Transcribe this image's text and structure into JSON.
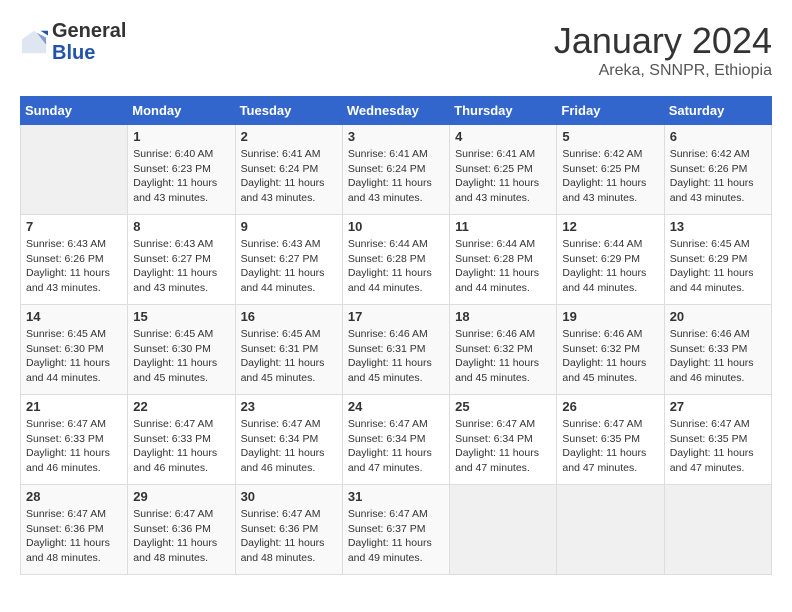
{
  "header": {
    "logo_general": "General",
    "logo_blue": "Blue",
    "month_title": "January 2024",
    "location": "Areka, SNNPR, Ethiopia"
  },
  "weekdays": [
    "Sunday",
    "Monday",
    "Tuesday",
    "Wednesday",
    "Thursday",
    "Friday",
    "Saturday"
  ],
  "weeks": [
    [
      {
        "day": "",
        "empty": true
      },
      {
        "day": "1",
        "sunrise": "6:40 AM",
        "sunset": "6:23 PM",
        "daylight": "11 hours and 43 minutes."
      },
      {
        "day": "2",
        "sunrise": "6:41 AM",
        "sunset": "6:24 PM",
        "daylight": "11 hours and 43 minutes."
      },
      {
        "day": "3",
        "sunrise": "6:41 AM",
        "sunset": "6:24 PM",
        "daylight": "11 hours and 43 minutes."
      },
      {
        "day": "4",
        "sunrise": "6:41 AM",
        "sunset": "6:25 PM",
        "daylight": "11 hours and 43 minutes."
      },
      {
        "day": "5",
        "sunrise": "6:42 AM",
        "sunset": "6:25 PM",
        "daylight": "11 hours and 43 minutes."
      },
      {
        "day": "6",
        "sunrise": "6:42 AM",
        "sunset": "6:26 PM",
        "daylight": "11 hours and 43 minutes."
      }
    ],
    [
      {
        "day": "7",
        "sunrise": "6:43 AM",
        "sunset": "6:26 PM",
        "daylight": "11 hours and 43 minutes."
      },
      {
        "day": "8",
        "sunrise": "6:43 AM",
        "sunset": "6:27 PM",
        "daylight": "11 hours and 43 minutes."
      },
      {
        "day": "9",
        "sunrise": "6:43 AM",
        "sunset": "6:27 PM",
        "daylight": "11 hours and 44 minutes."
      },
      {
        "day": "10",
        "sunrise": "6:44 AM",
        "sunset": "6:28 PM",
        "daylight": "11 hours and 44 minutes."
      },
      {
        "day": "11",
        "sunrise": "6:44 AM",
        "sunset": "6:28 PM",
        "daylight": "11 hours and 44 minutes."
      },
      {
        "day": "12",
        "sunrise": "6:44 AM",
        "sunset": "6:29 PM",
        "daylight": "11 hours and 44 minutes."
      },
      {
        "day": "13",
        "sunrise": "6:45 AM",
        "sunset": "6:29 PM",
        "daylight": "11 hours and 44 minutes."
      }
    ],
    [
      {
        "day": "14",
        "sunrise": "6:45 AM",
        "sunset": "6:30 PM",
        "daylight": "11 hours and 44 minutes."
      },
      {
        "day": "15",
        "sunrise": "6:45 AM",
        "sunset": "6:30 PM",
        "daylight": "11 hours and 45 minutes."
      },
      {
        "day": "16",
        "sunrise": "6:45 AM",
        "sunset": "6:31 PM",
        "daylight": "11 hours and 45 minutes."
      },
      {
        "day": "17",
        "sunrise": "6:46 AM",
        "sunset": "6:31 PM",
        "daylight": "11 hours and 45 minutes."
      },
      {
        "day": "18",
        "sunrise": "6:46 AM",
        "sunset": "6:32 PM",
        "daylight": "11 hours and 45 minutes."
      },
      {
        "day": "19",
        "sunrise": "6:46 AM",
        "sunset": "6:32 PM",
        "daylight": "11 hours and 45 minutes."
      },
      {
        "day": "20",
        "sunrise": "6:46 AM",
        "sunset": "6:33 PM",
        "daylight": "11 hours and 46 minutes."
      }
    ],
    [
      {
        "day": "21",
        "sunrise": "6:47 AM",
        "sunset": "6:33 PM",
        "daylight": "11 hours and 46 minutes."
      },
      {
        "day": "22",
        "sunrise": "6:47 AM",
        "sunset": "6:33 PM",
        "daylight": "11 hours and 46 minutes."
      },
      {
        "day": "23",
        "sunrise": "6:47 AM",
        "sunset": "6:34 PM",
        "daylight": "11 hours and 46 minutes."
      },
      {
        "day": "24",
        "sunrise": "6:47 AM",
        "sunset": "6:34 PM",
        "daylight": "11 hours and 47 minutes."
      },
      {
        "day": "25",
        "sunrise": "6:47 AM",
        "sunset": "6:34 PM",
        "daylight": "11 hours and 47 minutes."
      },
      {
        "day": "26",
        "sunrise": "6:47 AM",
        "sunset": "6:35 PM",
        "daylight": "11 hours and 47 minutes."
      },
      {
        "day": "27",
        "sunrise": "6:47 AM",
        "sunset": "6:35 PM",
        "daylight": "11 hours and 47 minutes."
      }
    ],
    [
      {
        "day": "28",
        "sunrise": "6:47 AM",
        "sunset": "6:36 PM",
        "daylight": "11 hours and 48 minutes."
      },
      {
        "day": "29",
        "sunrise": "6:47 AM",
        "sunset": "6:36 PM",
        "daylight": "11 hours and 48 minutes."
      },
      {
        "day": "30",
        "sunrise": "6:47 AM",
        "sunset": "6:36 PM",
        "daylight": "11 hours and 48 minutes."
      },
      {
        "day": "31",
        "sunrise": "6:47 AM",
        "sunset": "6:37 PM",
        "daylight": "11 hours and 49 minutes."
      },
      {
        "day": "",
        "empty": true
      },
      {
        "day": "",
        "empty": true
      },
      {
        "day": "",
        "empty": true
      }
    ]
  ],
  "labels": {
    "sunrise": "Sunrise:",
    "sunset": "Sunset:",
    "daylight": "Daylight:"
  }
}
